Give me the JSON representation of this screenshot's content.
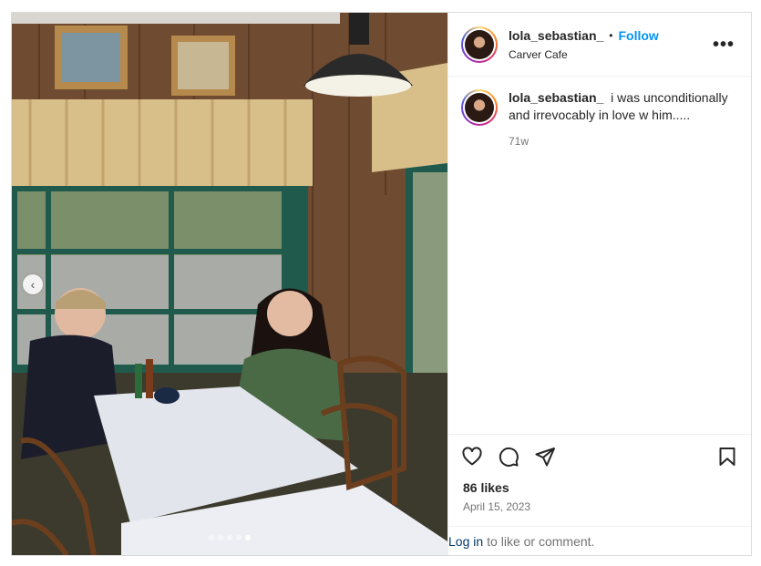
{
  "post": {
    "username": "lola_sebastian_",
    "follow_label": "Follow",
    "separator": "•",
    "location": "Carver Cafe",
    "more_label": "•••",
    "caption_text": "i was unconditionally and irrevocably in love w him.....",
    "caption_age": "71w",
    "likes": "86 likes",
    "date": "April 15, 2023"
  },
  "carousel": {
    "prev_label": "‹",
    "total_slides": 5,
    "active_index": 4
  },
  "icons": {
    "like": "heart-icon",
    "comment": "comment-icon",
    "share": "paper-plane-icon",
    "save": "bookmark-icon"
  },
  "footer": {
    "login_label": "Log in",
    "prompt": "to like or comment."
  },
  "colors": {
    "follow_blue": "#0095f6",
    "link_dark_blue": "#00376b",
    "muted_text": "#737373"
  }
}
